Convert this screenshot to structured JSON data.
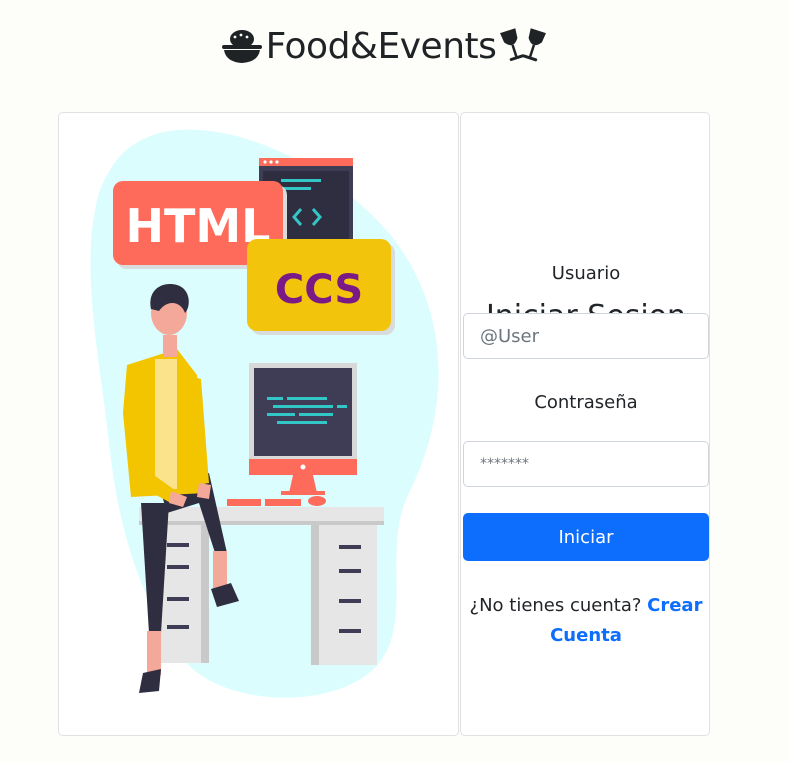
{
  "header": {
    "brand_name": "Food&Events"
  },
  "illustration": {
    "html_badge": "HTML",
    "css_badge": "CCS"
  },
  "login": {
    "title": "Iniciar Sesion",
    "username_label": "Usuario",
    "username_placeholder": "@User",
    "password_label": "Contraseña",
    "password_placeholder": "*******",
    "submit_label": "Iniciar",
    "no_account_text": "¿No tienes cuenta? ",
    "signup_link": "Crear Cuenta"
  },
  "colors": {
    "primary": "#0d6efd",
    "html_badge": "#ff6b5a",
    "css_badge": "#f2c50c",
    "css_text": "#7a1a86",
    "blob": "#dcfdfd",
    "shirt": "#f2c500"
  },
  "icons": [
    "food-bowl-icon",
    "wine-glasses-icon"
  ]
}
